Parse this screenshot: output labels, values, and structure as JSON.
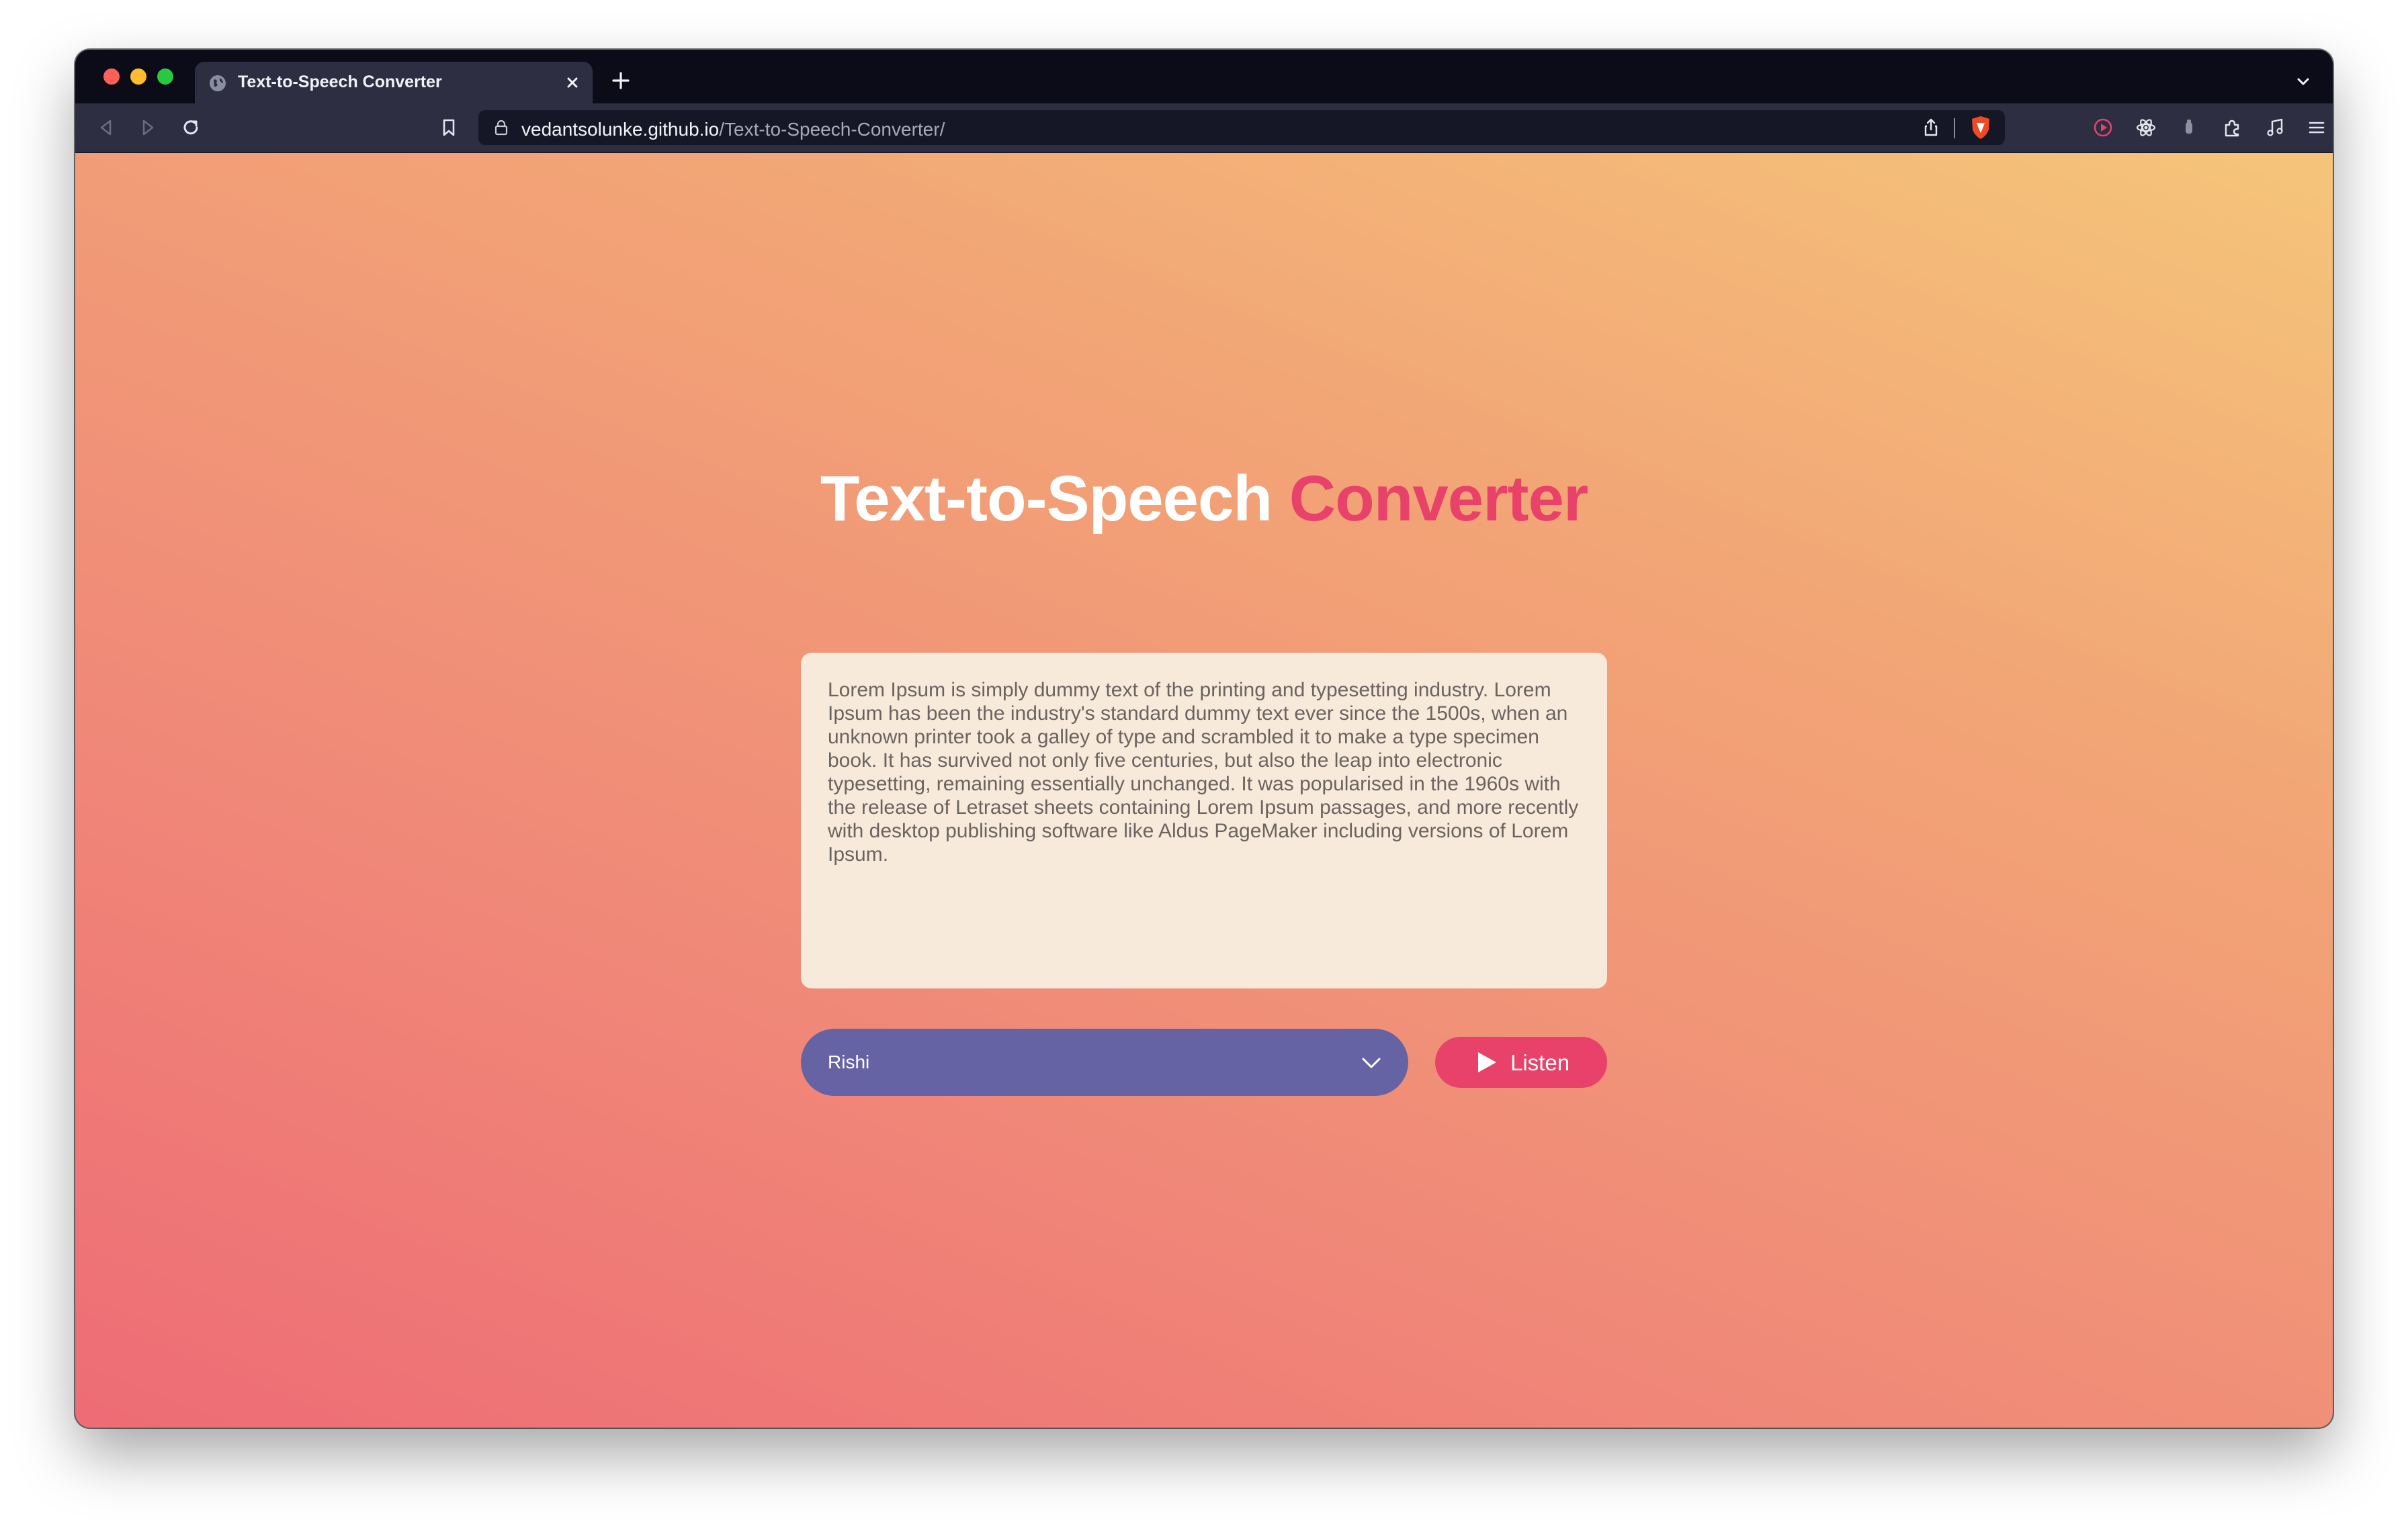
{
  "browser": {
    "tab": {
      "title": "Text-to-Speech Converter",
      "favicon": "globe-icon"
    },
    "address": {
      "host": "vedantsolunke.github.io",
      "path": "/Text-to-Speech-Converter/"
    },
    "toolbar_icons": [
      "back-icon",
      "forward-icon",
      "reload-icon",
      "bookmark-icon",
      "share-icon",
      "brave-shield-icon",
      "record-icon",
      "atom-icon",
      "wallet-icon",
      "extensions-icon",
      "media-icon",
      "menu-icon"
    ]
  },
  "page": {
    "title_part1": "Text-to-Speech",
    "title_part2": "Converter",
    "text_input": "Lorem Ipsum is simply dummy text of the printing and typesetting industry. Lorem Ipsum has been the industry's standard dummy text ever since the 1500s, when an unknown printer took a galley of type and scrambled it to make a type specimen book. It has survived not only five centuries, but also the leap into electronic typesetting, remaining essentially unchanged. It was popularised in the 1960s with the release of Letraset sheets containing Lorem Ipsum passages, and more recently with desktop publishing software like Aldus PageMaker including versions of Lorem Ipsum.",
    "voice_select": {
      "selected": "Rishi"
    },
    "listen_button": "Listen"
  },
  "colors": {
    "accent_pink": "#e8426a",
    "select_purple": "#6563a3",
    "textarea_bg": "#f8eada",
    "gradient_start": "#ee6c75",
    "gradient_end": "#f5c57a"
  }
}
